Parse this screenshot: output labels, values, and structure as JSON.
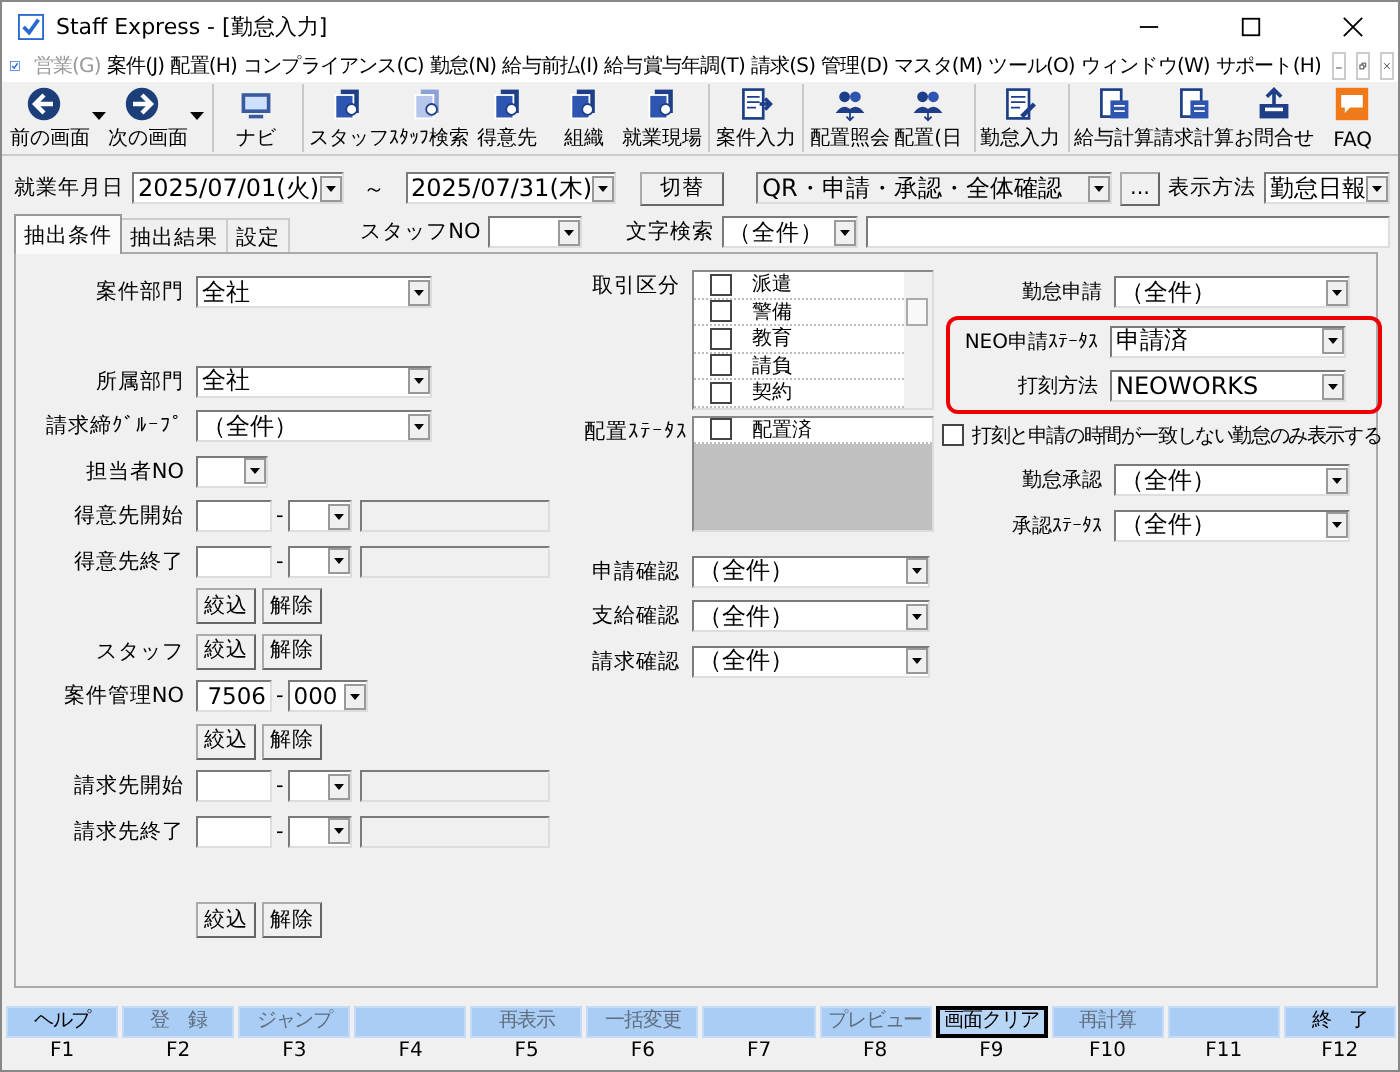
{
  "window": {
    "title": "Staff Express - [勤怠入力]"
  },
  "menu": [
    {
      "label": "営業(G)",
      "disabled": true
    },
    {
      "label": "案件(J)",
      "disabled": false
    },
    {
      "label": "配置(H)",
      "disabled": false
    },
    {
      "label": "コンプライアンス(C)",
      "disabled": false
    },
    {
      "label": "勤怠(N)",
      "disabled": false
    },
    {
      "label": "給与前払(I)",
      "disabled": false
    },
    {
      "label": "給与賞与年調(T)",
      "disabled": false
    },
    {
      "label": "請求(S)",
      "disabled": false
    },
    {
      "label": "管理(D)",
      "disabled": false
    },
    {
      "label": "マスタ(M)",
      "disabled": false
    },
    {
      "label": "ツール(O)",
      "disabled": false
    },
    {
      "label": "ウィンドウ(W)",
      "disabled": false
    },
    {
      "label": "サポート(H)",
      "disabled": false
    }
  ],
  "toolbar": [
    {
      "label": "前の画面",
      "kind": "back",
      "dropdown": true,
      "separator_before": false
    },
    {
      "label": "次の画面",
      "kind": "forward",
      "dropdown": true,
      "separator_before": false
    },
    {
      "label": "ナビ",
      "kind": "monitor",
      "dropdown": false,
      "separator_before": true
    },
    {
      "label": "スタッフ",
      "kind": "stack",
      "dropdown": false,
      "separator_before": true
    },
    {
      "label": "ｽﾀｯﾌ検索",
      "kind": "stack-light",
      "dropdown": false,
      "separator_before": false
    },
    {
      "label": "得意先",
      "kind": "stack",
      "dropdown": false,
      "separator_before": false
    },
    {
      "label": "組織",
      "kind": "stack",
      "dropdown": false,
      "separator_before": false
    },
    {
      "label": "就業現場",
      "kind": "stack",
      "dropdown": false,
      "separator_before": false
    },
    {
      "label": "案件入力",
      "kind": "form-arrow",
      "dropdown": false,
      "separator_before": true
    },
    {
      "label": "配置照会",
      "kind": "people",
      "dropdown": false,
      "separator_before": true
    },
    {
      "label": "配置(日",
      "kind": "people",
      "dropdown": false,
      "separator_before": false
    },
    {
      "label": "勤怠入力",
      "kind": "form-pen",
      "dropdown": false,
      "separator_before": true
    },
    {
      "label": "給与計算",
      "kind": "calc",
      "dropdown": false,
      "separator_before": true
    },
    {
      "label": "請求計算",
      "kind": "calc",
      "dropdown": false,
      "separator_before": false
    },
    {
      "label": "お問合せ",
      "kind": "upload",
      "dropdown": false,
      "separator_before": false
    },
    {
      "label": "FAQ",
      "kind": "faq",
      "dropdown": false,
      "separator_before": false
    }
  ],
  "filters": {
    "date_label": "就業年月日",
    "date_from": "2025/07/01(火)",
    "range_sign": "～",
    "date_to": "2025/07/31(木)",
    "switch_button": "切替",
    "preset": "QR・申請・承認・全体確認",
    "more_button": "...",
    "display_label": "表示方法",
    "display_value": "勤怠日報",
    "staff_no_label": "スタッフNO",
    "search_label": "文字検索",
    "search_scope": "（全件）"
  },
  "tabs": [
    {
      "label": "抽出条件",
      "selected": true
    },
    {
      "label": "抽出結果",
      "selected": false
    },
    {
      "label": "設定",
      "selected": false
    }
  ],
  "left_fields": [
    {
      "kind": "select",
      "label": "案件部門",
      "value": "全社"
    },
    {
      "kind": "select",
      "label": "所属部門",
      "value": "全社"
    },
    {
      "kind": "select",
      "label": "請求締ｸﾞﾙｰﾌﾟ",
      "value": "（全件）"
    },
    {
      "kind": "small-select",
      "label": "担当者NO"
    },
    {
      "kind": "range",
      "label": "得意先開始",
      "separator": "-"
    },
    {
      "kind": "range",
      "label": "得意先終了",
      "separator": "-"
    },
    {
      "kind": "buttons",
      "buttons": [
        "絞込",
        "解除"
      ]
    },
    {
      "kind": "buttons",
      "label": "スタッフ",
      "buttons": [
        "絞込",
        "解除"
      ]
    },
    {
      "kind": "number",
      "label": "案件管理NO",
      "value": "7506",
      "separator": "-",
      "option": "000"
    },
    {
      "kind": "buttons",
      "buttons": [
        "絞込",
        "解除"
      ]
    },
    {
      "kind": "range",
      "label": "請求先開始",
      "separator": "-"
    },
    {
      "kind": "range",
      "label": "請求先終了",
      "separator": "-"
    },
    {
      "kind": "buttons",
      "buttons": [
        "絞込",
        "解除"
      ]
    }
  ],
  "trade_type": {
    "label": "取引区分",
    "items": [
      {
        "label": "派遣",
        "checked": false
      },
      {
        "label": "警備",
        "checked": false
      },
      {
        "label": "教育",
        "checked": false
      },
      {
        "label": "請負",
        "checked": false
      },
      {
        "label": "契約",
        "checked": false
      }
    ]
  },
  "placement_status": {
    "label": "配置ｽﾃｰﾀｽ",
    "items": [
      {
        "label": "配置済",
        "checked": false
      }
    ]
  },
  "middle_fields": [
    {
      "label": "申請確認",
      "value": "（全件）"
    },
    {
      "label": "支給確認",
      "value": "（全件）"
    },
    {
      "label": "請求確認",
      "value": "（全件）"
    }
  ],
  "right_fields": [
    {
      "kind": "select",
      "label": "勤怠申請",
      "value": "（全件）",
      "highlighted": false
    },
    {
      "kind": "select",
      "label": "NEO申請ｽﾃｰﾀｽ",
      "value": "申請済",
      "highlighted": true
    },
    {
      "kind": "select",
      "label": "打刻方法",
      "value": "NEOWORKS",
      "highlighted": true
    },
    {
      "kind": "checkbox",
      "label": "打刻と申請の時間が一致しない勤怠のみ表示する",
      "checked": false
    },
    {
      "kind": "select",
      "label": "勤怠承認",
      "value": "（全件）",
      "highlighted": false
    },
    {
      "kind": "select",
      "label": "承認ｽﾃｰﾀｽ",
      "value": "（全件）",
      "highlighted": false
    }
  ],
  "function_keys": [
    {
      "label": "ヘルプ",
      "key": "F1",
      "disabled": false,
      "focused": false
    },
    {
      "label": "登　録",
      "key": "F2",
      "disabled": true,
      "focused": false
    },
    {
      "label": "ジャンプ",
      "key": "F3",
      "disabled": true,
      "focused": false
    },
    {
      "key": "F4",
      "focused": false
    },
    {
      "label": "再表示",
      "key": "F5",
      "disabled": true,
      "focused": false
    },
    {
      "label": "一括変更",
      "key": "F6",
      "disabled": true,
      "focused": false
    },
    {
      "key": "F7",
      "focused": false
    },
    {
      "label": "プレビュー",
      "key": "F8",
      "disabled": true,
      "focused": false
    },
    {
      "label": "画面クリア",
      "key": "F9",
      "disabled": false,
      "focused": true
    },
    {
      "label": "再計算",
      "key": "F10",
      "disabled": true,
      "focused": false
    },
    {
      "key": "F11",
      "focused": false
    },
    {
      "label": "終　了",
      "key": "F12",
      "disabled": false,
      "focused": false
    }
  ]
}
